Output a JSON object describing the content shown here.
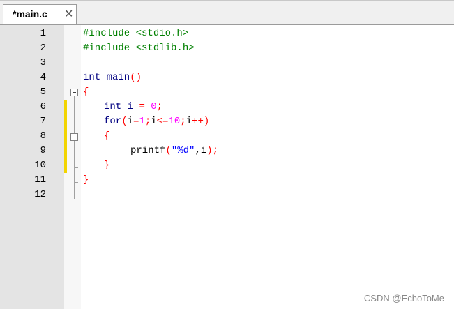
{
  "tab": {
    "title": "*main.c",
    "close": "✕"
  },
  "lines": [
    "1",
    "2",
    "3",
    "4",
    "5",
    "6",
    "7",
    "8",
    "9",
    "10",
    "11",
    "12"
  ],
  "code": {
    "l1": {
      "pp": "#include <stdio.h>"
    },
    "l2": {
      "pp": "#include <stdlib.h>"
    },
    "l4": {
      "t": "int main",
      "op": "()"
    },
    "l5": {
      "op": "{"
    },
    "l6": {
      "kw": "int",
      "id": " i ",
      "eq": "=",
      "sp": " ",
      "num": "0",
      "semi": ";"
    },
    "l7": {
      "kw": "for",
      "p1": "(",
      "i1": "i",
      "eq": "=",
      "n1": "1",
      "s1": ";",
      "i2": "i",
      "le": "<=",
      "n2": "10",
      "s2": ";",
      "i3": "i",
      "pp": "++",
      "p2": ")"
    },
    "l8": {
      "op": "{"
    },
    "l9": {
      "fn": "printf",
      "p1": "(",
      "str": "\"%d\"",
      "comma": ",i",
      "p2": ");"
    },
    "l10": {
      "op": "}"
    },
    "l11": {
      "op": "}"
    }
  },
  "watermark": "CSDN @EchoToMe"
}
